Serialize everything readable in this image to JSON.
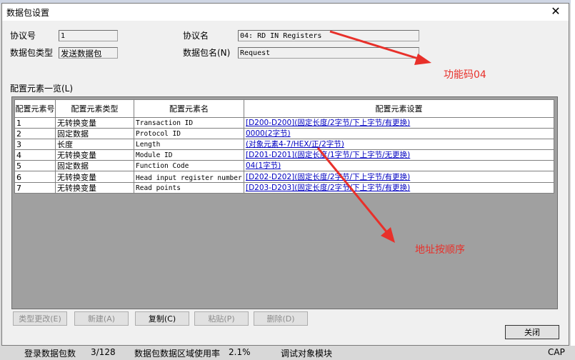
{
  "dialog": {
    "title": "数据包设置",
    "close_glyph": "✕"
  },
  "form": {
    "protocol_no_label": "协议号",
    "protocol_no_value": "1",
    "packet_type_label": "数据包类型",
    "packet_type_value": "发送数据包",
    "protocol_name_label": "协议名",
    "protocol_name_value": "04: RD IN Registers",
    "packet_name_label": "数据包名(N)",
    "packet_name_value": "Request"
  },
  "grid": {
    "section_label": "配置元素一览(L)",
    "headers": [
      "配置元素号",
      "配置元素类型",
      "配置元素名",
      "配置元素设置"
    ],
    "rows": [
      {
        "no": "1",
        "type": "无转换变量",
        "name": "Transaction ID",
        "setting": "[D200-D200](固定长度/2字节/下上字节/有更换)"
      },
      {
        "no": "2",
        "type": "固定数据",
        "name": "Protocol ID",
        "setting": "0000(2字节)"
      },
      {
        "no": "3",
        "type": "长度",
        "name": "Length",
        "setting": "(对象元素4-7/HEX/正/2字节)"
      },
      {
        "no": "4",
        "type": "无转换变量",
        "name": "Module ID",
        "setting": "[D201-D201](固定长度/1字节/下上字节/无更换)"
      },
      {
        "no": "5",
        "type": "固定数据",
        "name": "Function Code",
        "setting": "04(1字节)"
      },
      {
        "no": "6",
        "type": "无转换变量",
        "name": "Head input register number",
        "setting": "[D202-D202](固定长度/2字节/下上字节/有更换)"
      },
      {
        "no": "7",
        "type": "无转换变量",
        "name": "Read points",
        "setting": "[D203-D203](固定长度/2字节/下上字节/有更换)"
      }
    ]
  },
  "buttons": {
    "change_type": "类型更改(E)",
    "new": "新建(A)",
    "copy": "复制(C)",
    "paste": "粘贴(P)",
    "delete": "删除(D)",
    "close": "关闭"
  },
  "annotations": {
    "function_code": "功能码04",
    "address_order": "地址按顺序",
    "color": "#e8302a"
  },
  "statusbar": {
    "logged_packets_label": "登录数据包数",
    "logged_packets_value": "3/128",
    "area_usage_label": "数据包数据区域使用率",
    "area_usage_value": "2.1%",
    "debug_module": "调试对象模块",
    "cap": "CAP"
  }
}
